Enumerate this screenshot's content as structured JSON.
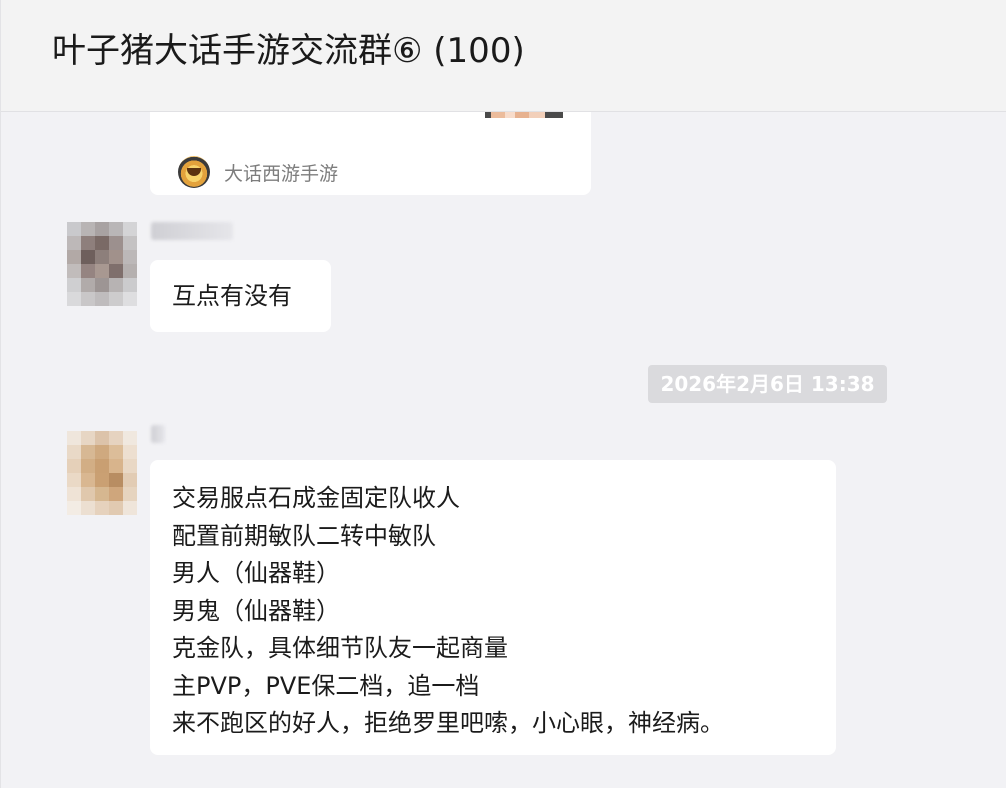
{
  "header": {
    "title": "叶子猪大话手游交流群⑥ (100)"
  },
  "shared_card": {
    "source_icon": "dahua-game-icon",
    "source_label": "大话西游手游"
  },
  "messages": [
    {
      "avatar": "blurred-avatar",
      "text": "互点有没有"
    },
    {
      "avatar": "blurred-avatar",
      "lines": [
        "交易服点石成金固定队收人",
        "配置前期敏队二转中敏队",
        "男人（仙器鞋）",
        "男鬼（仙器鞋）",
        "克金队，具体细节队友一起商量",
        "主PVP，PVE保二档，追一档",
        "来不跑区的好人，拒绝罗里吧嗦，小心眼，神经病。"
      ]
    }
  ],
  "timestamp": "2026年2月6日 13:38",
  "colors": {
    "background": "#f2f2f5",
    "bubble": "#ffffff",
    "timestamp_bg": "#dadadd",
    "text": "#1b1b1b"
  }
}
